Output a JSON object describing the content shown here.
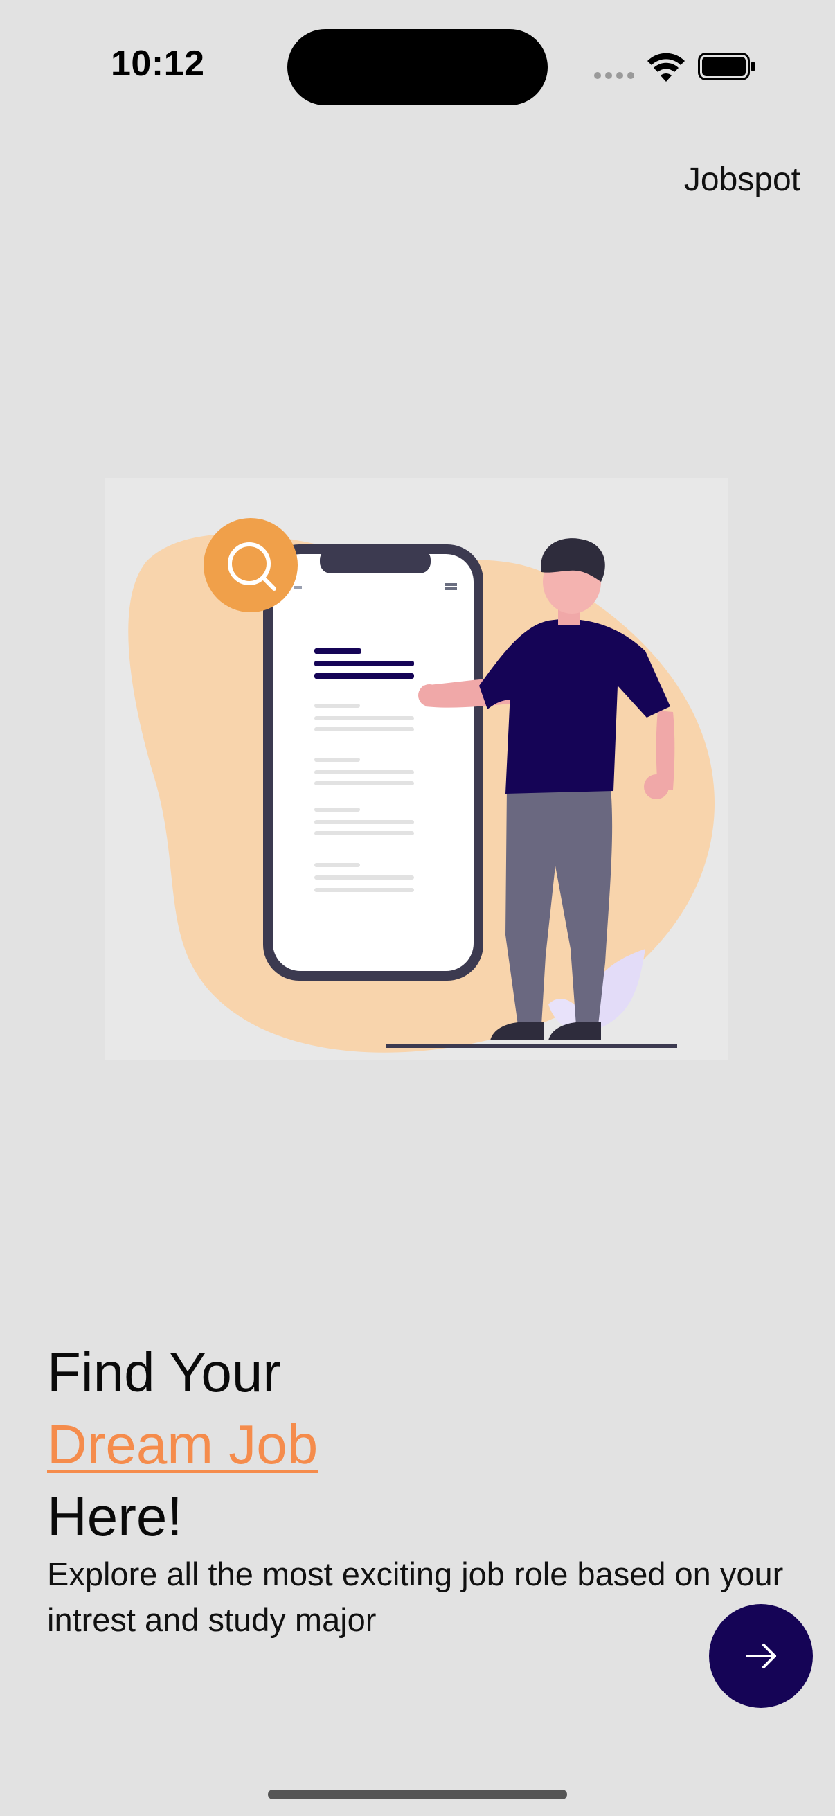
{
  "status_bar": {
    "time": "10:12"
  },
  "header": {
    "brand": "Jobspot"
  },
  "hero": {
    "title_line1": "Find Your",
    "title_accent": "Dream Job",
    "title_line3": "Here!",
    "subtitle": "Explore all the  most exciting job role based on your intrest and study major"
  },
  "actions": {
    "next_icon": "arrow-right-icon"
  },
  "colors": {
    "background": "#e2e2e2",
    "accent": "#f58c4c",
    "primary": "#150456",
    "blob": "#f8d4ac",
    "search_circle": "#f0a04a"
  },
  "icons": {
    "illustration": "person-with-phone-illustration",
    "wifi": "wifi-icon",
    "battery": "battery-icon",
    "signal": "cellular-signal-icon"
  }
}
